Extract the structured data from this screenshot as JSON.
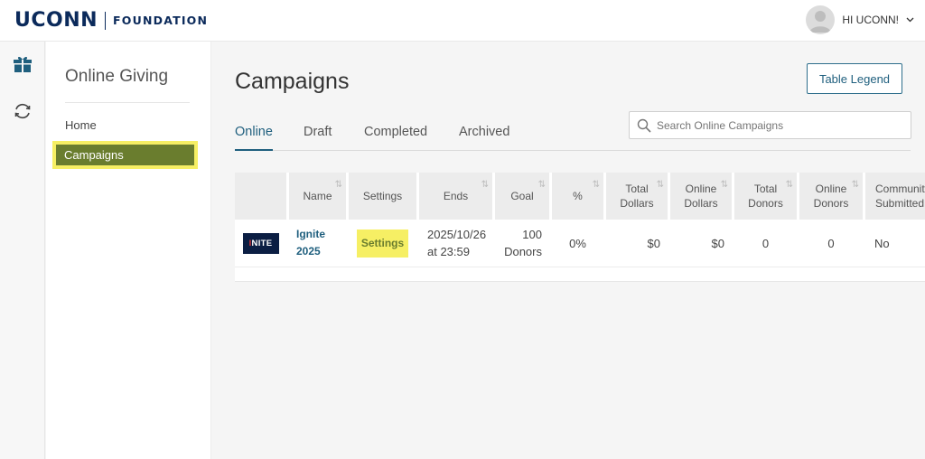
{
  "header": {
    "logo_main": "UCONN",
    "logo_sub": "FOUNDATION",
    "user_greeting": "HI UCONN!"
  },
  "icons": {
    "rail": [
      "gift-icon",
      "sync-icon"
    ],
    "search": "search-icon",
    "user_menu": "chevron-down-icon"
  },
  "sidenav": {
    "title": "Online Giving",
    "items": [
      {
        "label": "Home",
        "active": false
      },
      {
        "label": "Campaigns",
        "active": true
      }
    ]
  },
  "main": {
    "title": "Campaigns",
    "legend_button": "Table Legend",
    "tabs": [
      {
        "label": "Online",
        "active": true
      },
      {
        "label": "Draft",
        "active": false
      },
      {
        "label": "Completed",
        "active": false
      },
      {
        "label": "Archived",
        "active": false
      }
    ],
    "search_placeholder": "Search Online Campaigns"
  },
  "table": {
    "columns": [
      {
        "key": "thumb",
        "label": ""
      },
      {
        "key": "name",
        "label": "Name"
      },
      {
        "key": "settings",
        "label": "Settings"
      },
      {
        "key": "ends",
        "label": "Ends"
      },
      {
        "key": "goal",
        "label": "Goal"
      },
      {
        "key": "pct",
        "label": "%"
      },
      {
        "key": "total_dollars",
        "label": "Total\nDollars"
      },
      {
        "key": "online_dollars",
        "label": "Online\nDollars"
      },
      {
        "key": "total_donors",
        "label": "Total\nDonors"
      },
      {
        "key": "online_donors",
        "label": "Online\nDonors"
      },
      {
        "key": "community",
        "label": "Community\nSubmitted"
      }
    ],
    "rows": [
      {
        "thumb_text_a": "I",
        "thumb_text_b": "NITE",
        "name_line1": "Ignite",
        "name_line2": "2025",
        "settings": "Settings",
        "ends_line1": "2025/10/26",
        "ends_line2": "at 23:59",
        "goal_line1": "100",
        "goal_line2": "Donors",
        "pct": "0%",
        "total_dollars": "$0",
        "online_dollars": "$0",
        "total_donors": "0",
        "online_donors": "0",
        "community": "No"
      }
    ]
  },
  "colors": {
    "brand_navy": "#0b2a5b",
    "link_blue": "#1f5f7e",
    "highlight_yellow": "#f6ef64",
    "active_nav_green": "#6a7d2e"
  }
}
